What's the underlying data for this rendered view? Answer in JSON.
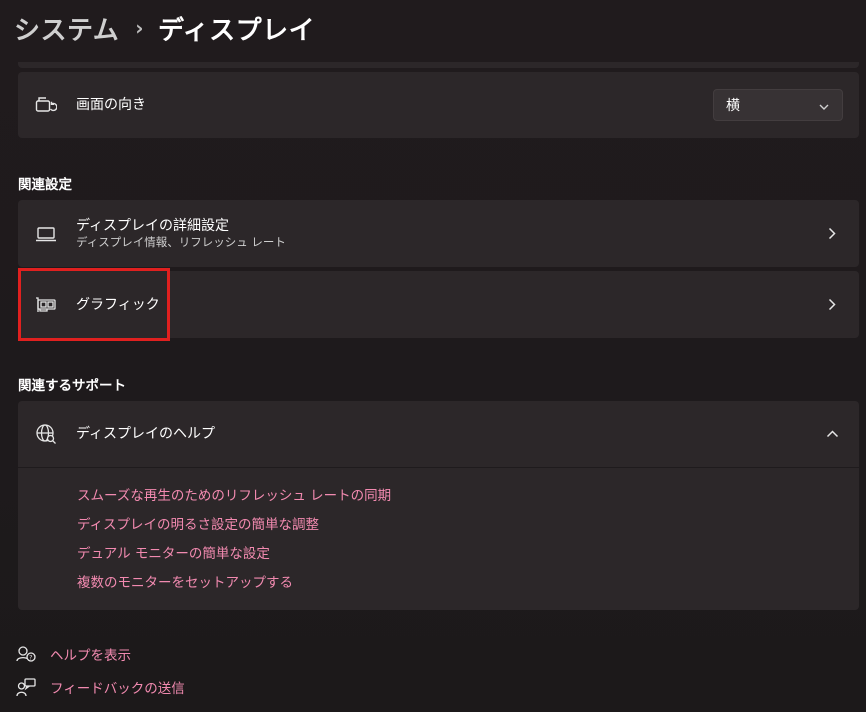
{
  "breadcrumb": {
    "parent": "システム",
    "separator": "›",
    "current": "ディスプレイ"
  },
  "orientation": {
    "label": "画面の向き",
    "icon": "screen-rotate-icon",
    "dropdown_value": "横"
  },
  "related_settings": {
    "heading": "関連設定",
    "items": [
      {
        "title": "ディスプレイの詳細設定",
        "subtitle": "ディスプレイ情報、リフレッシュ レート",
        "icon": "laptop-icon"
      },
      {
        "title": "グラフィック",
        "subtitle": "",
        "icon": "graphics-card-icon"
      }
    ]
  },
  "related_support": {
    "heading": "関連するサポート",
    "help": {
      "title": "ディスプレイのヘルプ",
      "icon": "globe-search-icon",
      "links": [
        "スムーズな再生のためのリフレッシュ レートの同期",
        "ディスプレイの明るさ設定の簡単な調整",
        "デュアル モニターの簡単な設定",
        "複数のモニターをセットアップする"
      ]
    }
  },
  "footer": {
    "get_help": "ヘルプを表示",
    "feedback": "フィードバックの送信"
  },
  "colors": {
    "accent_link": "#f28ab0",
    "highlight_box": "#e0201f",
    "card_bg": "#2c2729"
  }
}
